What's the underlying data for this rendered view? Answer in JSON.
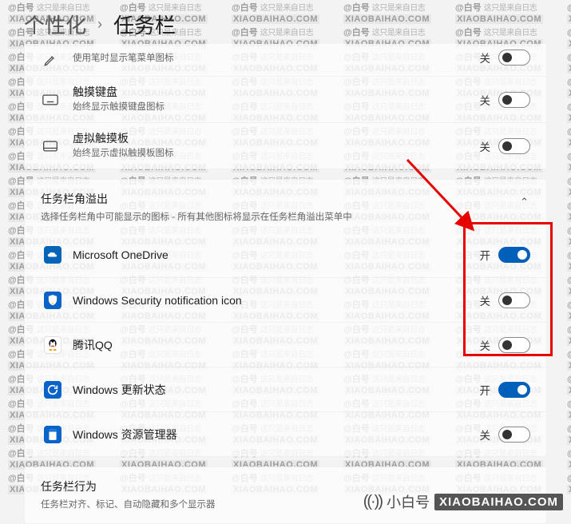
{
  "breadcrumb": {
    "parent": "个性化",
    "current": "任务栏"
  },
  "topRows": [
    {
      "icon": "pen",
      "title": "",
      "sub": "使用笔时显示笔菜单图标",
      "state": "关",
      "on": false
    },
    {
      "icon": "keyboard",
      "title": "触摸键盘",
      "sub": "始终显示触摸键盘图标",
      "state": "关",
      "on": false
    },
    {
      "icon": "touchpad",
      "title": "虚拟触摸板",
      "sub": "始终显示虚拟触摸板图标",
      "state": "关",
      "on": false
    }
  ],
  "overflow": {
    "title": "任务栏角溢出",
    "sub": "选择任务栏角中可能显示的图标 - 所有其他图标将显示在任务栏角溢出菜单中",
    "items": [
      {
        "icon": "onedrive",
        "label": "Microsoft OneDrive",
        "state": "开",
        "on": true
      },
      {
        "icon": "security",
        "label": "Windows Security notification icon",
        "state": "关",
        "on": false
      },
      {
        "icon": "qq",
        "label": "腾讯QQ",
        "state": "关",
        "on": false
      },
      {
        "icon": "update",
        "label": "Windows 更新状态",
        "state": "开",
        "on": true
      },
      {
        "icon": "explorer",
        "label": "Windows 资源管理器",
        "state": "关",
        "on": false
      }
    ]
  },
  "behavior": {
    "title": "任务栏行为",
    "sub": "任务栏对齐、标记、自动隐藏和多个显示器"
  },
  "watermark": {
    "handle": "@白号",
    "extra": "这只是来自日志",
    "domain": "XIAOBAIHAO.COM",
    "footerCn": "小白号",
    "footerEn": "XIAOBAIHAO.COM"
  }
}
